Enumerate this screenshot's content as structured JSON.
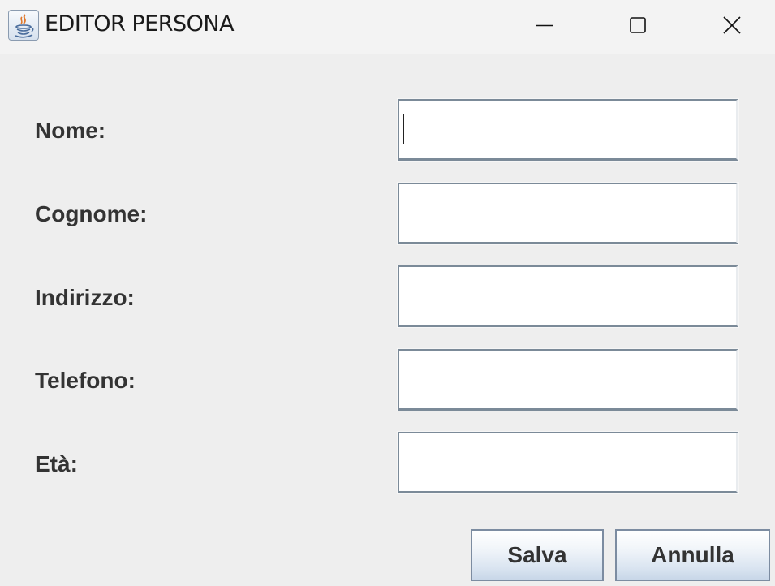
{
  "window": {
    "title": "EDITOR PERSONA",
    "icon": "java-cup-icon",
    "controls": [
      "minimize-icon",
      "maximize-icon",
      "close-icon"
    ]
  },
  "form": {
    "fields": [
      {
        "label": "Nome:",
        "value": "",
        "focused": true
      },
      {
        "label": "Cognome:",
        "value": "",
        "focused": false
      },
      {
        "label": "Indirizzo:",
        "value": "",
        "focused": false
      },
      {
        "label": "Telefono:",
        "value": "",
        "focused": false
      },
      {
        "label": "Età:",
        "value": "",
        "focused": false
      }
    ]
  },
  "buttons": {
    "save_label": "Salva",
    "cancel_label": "Annulla"
  },
  "colors": {
    "background": "#eeeeee",
    "titlebar": "#f3f3f3",
    "label_text": "#333333",
    "input_border": "#7b8a98",
    "button_border": "#7c8ca1"
  }
}
